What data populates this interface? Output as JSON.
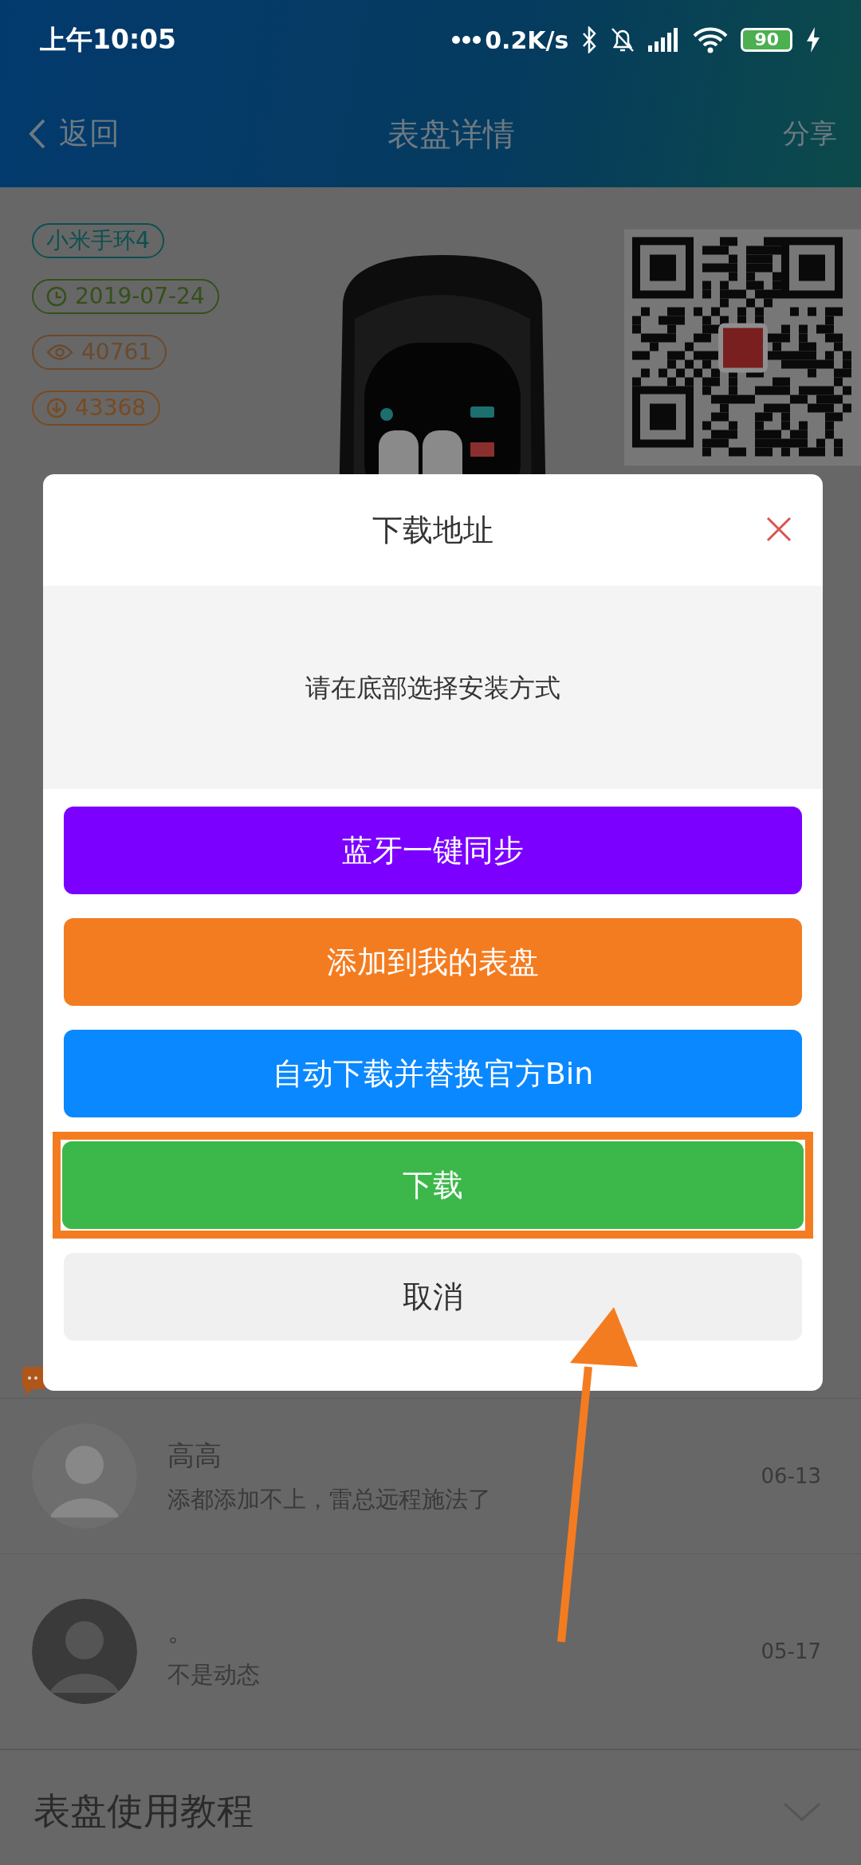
{
  "status_bar": {
    "time": "上午10:05",
    "network_speed": "0.2K/s",
    "battery": "90"
  },
  "nav": {
    "back": "返回",
    "title": "表盘详情",
    "action": "分享"
  },
  "tags": [
    {
      "kind": "model",
      "text": "小米手环4",
      "color": "#0e4f4f"
    },
    {
      "kind": "date",
      "text": "2019-07-24",
      "color": "#34501a"
    },
    {
      "kind": "views",
      "text": "40761",
      "color": "#6b4a2e"
    },
    {
      "kind": "downloads",
      "text": "43368",
      "color": "#7a4a20"
    }
  ],
  "dialog": {
    "title": "下载地址",
    "message": "请在底部选择安装方式",
    "buttons": [
      {
        "kind": "action",
        "label": "蓝牙一键同步",
        "color": "#7b00ff",
        "highlighted": false
      },
      {
        "kind": "action",
        "label": "添加到我的表盘",
        "color": "#f47c20",
        "highlighted": false
      },
      {
        "kind": "action",
        "label": "自动下载并替换官方Bin",
        "color": "#0a88ff",
        "highlighted": false
      },
      {
        "kind": "action",
        "label": "下载",
        "color": "#3cb84a",
        "highlighted": true
      },
      {
        "kind": "cancel",
        "label": "取消",
        "color": "#f0f0f0",
        "highlighted": false
      }
    ]
  },
  "comments": [
    {
      "name": "高高",
      "text": "添都添加不上，雷总远程施法了",
      "date": "06-13"
    },
    {
      "name": "。",
      "text": "不是动态",
      "date": "05-17"
    }
  ],
  "tutorial": {
    "title": "表盘使用教程",
    "expanded": false
  }
}
